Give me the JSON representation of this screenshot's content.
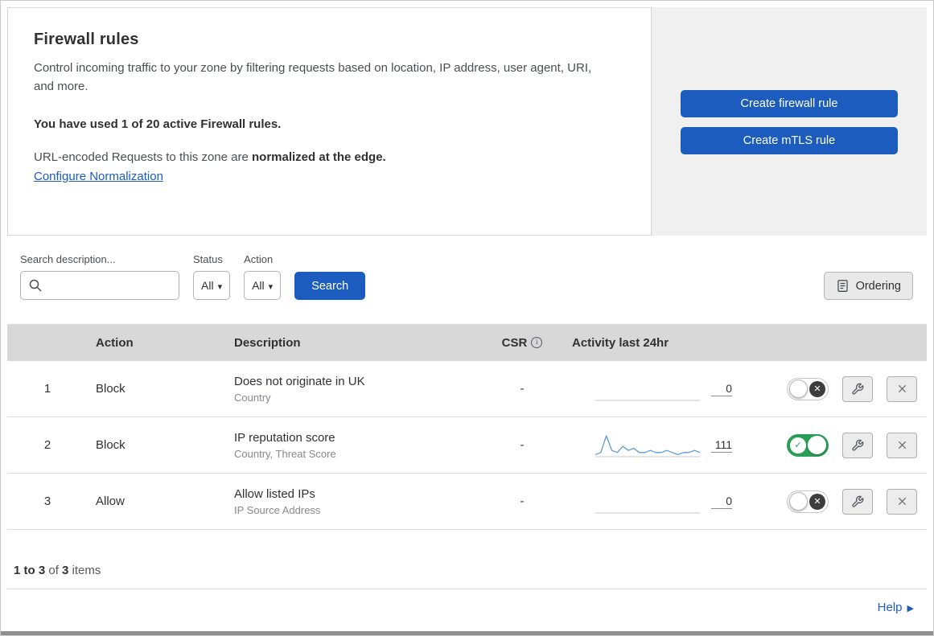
{
  "header": {
    "title": "Firewall rules",
    "description": "Control incoming traffic to your zone by filtering requests based on location, IP address, user agent, URI, and more.",
    "usage": "You have used 1 of 20 active Firewall rules.",
    "normalization_prefix": "URL-encoded Requests to this zone are ",
    "normalization_bold": "normalized at the edge.",
    "configure_link": "Configure Normalization",
    "create_firewall_button": "Create firewall rule",
    "create_mtls_button": "Create mTLS rule"
  },
  "filters": {
    "search_label": "Search description...",
    "status_label": "Status",
    "status_value": "All",
    "action_label": "Action",
    "action_value": "All",
    "search_button": "Search",
    "ordering_button": "Ordering"
  },
  "table": {
    "columns": {
      "action": "Action",
      "description": "Description",
      "csr": "CSR",
      "activity": "Activity last 24hr"
    },
    "rows": [
      {
        "num": "1",
        "action": "Block",
        "description": "Does not originate in UK",
        "detail": "Country",
        "csr": "-",
        "activity": "0",
        "enabled": false,
        "sparkline": null
      },
      {
        "num": "2",
        "action": "Block",
        "description": "IP reputation score",
        "detail": "Country, Threat Score",
        "csr": "-",
        "activity": "111",
        "enabled": true,
        "sparkline": [
          1,
          2,
          10,
          3,
          2,
          5,
          3,
          4,
          2,
          2,
          3,
          2,
          2,
          3,
          2,
          1,
          2,
          2,
          3,
          2
        ]
      },
      {
        "num": "3",
        "action": "Allow",
        "description": "Allow listed IPs",
        "detail": "IP Source Address",
        "csr": "-",
        "activity": "0",
        "enabled": false,
        "sparkline": null
      }
    ]
  },
  "footer": {
    "range": "1 to 3",
    "of_text": " of ",
    "total": "3",
    "items_text": " items",
    "help_link": "Help"
  },
  "colors": {
    "accent_blue": "#1b5cbe",
    "link_blue": "#1b5cbe",
    "toggle_green": "#2a9d56",
    "sparkline_blue": "#5b9bd5",
    "table_header_gray": "#d8d8d8",
    "side_panel_gray": "#f0f0f0"
  }
}
